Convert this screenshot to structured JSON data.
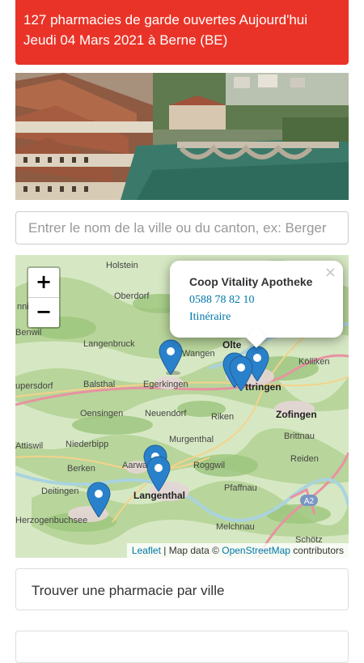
{
  "banner": {
    "line1": "127 pharmacies de garde ouvertes Aujourd'hui",
    "line2": "Jeudi 04 Mars 2021 à Berne (BE)"
  },
  "search": {
    "placeholder": "Entrer le nom de la ville ou du canton, ex: Berger"
  },
  "map": {
    "zoom_in": "+",
    "zoom_out": "−",
    "popup": {
      "close": "×",
      "name": "Coop Vitality Apotheke",
      "phone": "0588 78 82 10",
      "route": "Itinéraire"
    },
    "attribution": {
      "leaflet": "Leaflet",
      "sep": " | Map data © ",
      "osm": "OpenStreetMap",
      "suffix": " contributors"
    },
    "places": [
      "Holstein",
      "Oberdorf",
      "nningen",
      "Benwil",
      "Langenbruck",
      "Wangen",
      "Olte",
      "Kölliken",
      "upersdorf",
      "Balsthal",
      "Egerkingen",
      "ttringen",
      "Oensingen",
      "Neuendorf",
      "Riken",
      "Zofingen",
      "Attiswil",
      "Niederbipp",
      "Murgenthal",
      "Brittnau",
      "Berken",
      "Aarwangen",
      "Roggwil",
      "Reiden",
      "Deitingen",
      "Langenthal",
      "Pfaffnau",
      "Herzogenbuchsee",
      "Melchnau",
      "Schötz"
    ]
  },
  "cards": {
    "find_by_city": "Trouver une pharmacie par ville"
  },
  "colors": {
    "banner": "#ea3328",
    "link": "#0078a8",
    "marker": "#2a81cb"
  }
}
